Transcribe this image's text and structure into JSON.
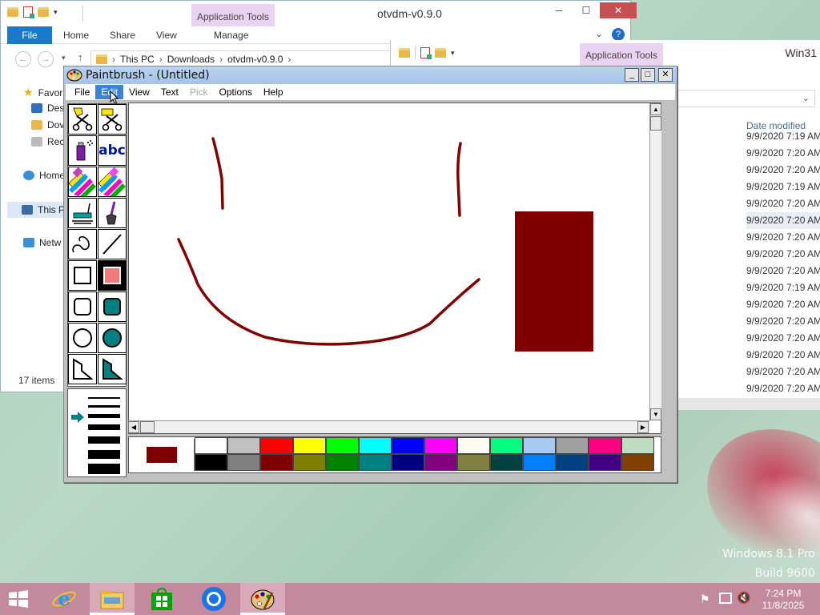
{
  "wallpaper": {
    "os_name": "Windows 8.1 Pro",
    "build": "Build 9600"
  },
  "explorer_back": {
    "title": "otvdm-v0.9.0",
    "context_tab": "Application Tools",
    "ribbon_tabs": [
      "File",
      "Home",
      "Share",
      "View",
      "Manage"
    ],
    "breadcrumb": [
      "This PC",
      "Downloads",
      "otvdm-v0.9.0"
    ],
    "nav_items": [
      "Favor",
      "Des",
      "Dov",
      "Rec",
      "Home",
      "This P",
      "Netw"
    ],
    "items_count": "17 items"
  },
  "explorer_front": {
    "title": "Win31",
    "context_tab": "Application Tools",
    "column_header": "Date modified",
    "dates": [
      "9/9/2020 7:19 AM",
      "9/9/2020 7:20 AM",
      "9/9/2020 7:20 AM",
      "9/9/2020 7:19 AM",
      "9/9/2020 7:20 AM",
      "9/9/2020 7:20 AM",
      "9/9/2020 7:20 AM",
      "9/9/2020 7:20 AM",
      "9/9/2020 7:20 AM",
      "9/9/2020 7:19 AM",
      "9/9/2020 7:20 AM",
      "9/9/2020 7:20 AM",
      "9/9/2020 7:20 AM",
      "9/9/2020 7:20 AM",
      "9/9/2020 7:20 AM",
      "9/9/2020 7:20 AM"
    ]
  },
  "paintbrush": {
    "title": "Paintbrush - (Untitled)",
    "menu": [
      "File",
      "Edit",
      "View",
      "Text",
      "Pick",
      "Options",
      "Help"
    ],
    "active_menu": "Edit",
    "disabled_menu": "Pick",
    "tools": [
      "scissors-icon",
      "pick-scissors-icon",
      "airbrush-icon",
      "text-tool-icon",
      "color-eraser-icon",
      "eraser-icon",
      "paint-roller-icon",
      "brush-icon",
      "curve-icon",
      "line-icon",
      "box-icon",
      "filled-box-icon",
      "rounded-box-icon",
      "filled-rounded-box-icon",
      "circle-icon",
      "filled-circle-icon",
      "polygon-icon",
      "filled-polygon-icon"
    ],
    "text_tool_label": "abc",
    "foreground_color": "#800000",
    "palette_top": [
      "#ffffff",
      "#c0c0c0",
      "#ff0000",
      "#ffff00",
      "#00ff00",
      "#00ffff",
      "#0000ff",
      "#ff00ff",
      "#fffbf0",
      "#00ff80",
      "#a6caf0",
      "#a0a0a0",
      "#ff0080",
      "#c0dcc0"
    ],
    "palette_bottom": [
      "#000000",
      "#808080",
      "#800000",
      "#808000",
      "#008000",
      "#008080",
      "#000080",
      "#800080",
      "#808040",
      "#004040",
      "#0080ff",
      "#004080",
      "#400080",
      "#804000"
    ]
  },
  "taskbar": {
    "time": "7:24 PM",
    "date": "11/8/2025",
    "apps": [
      "internet-explorer-icon",
      "file-explorer-icon",
      "store-icon",
      "chrome-icon",
      "paintbrush-icon"
    ]
  }
}
